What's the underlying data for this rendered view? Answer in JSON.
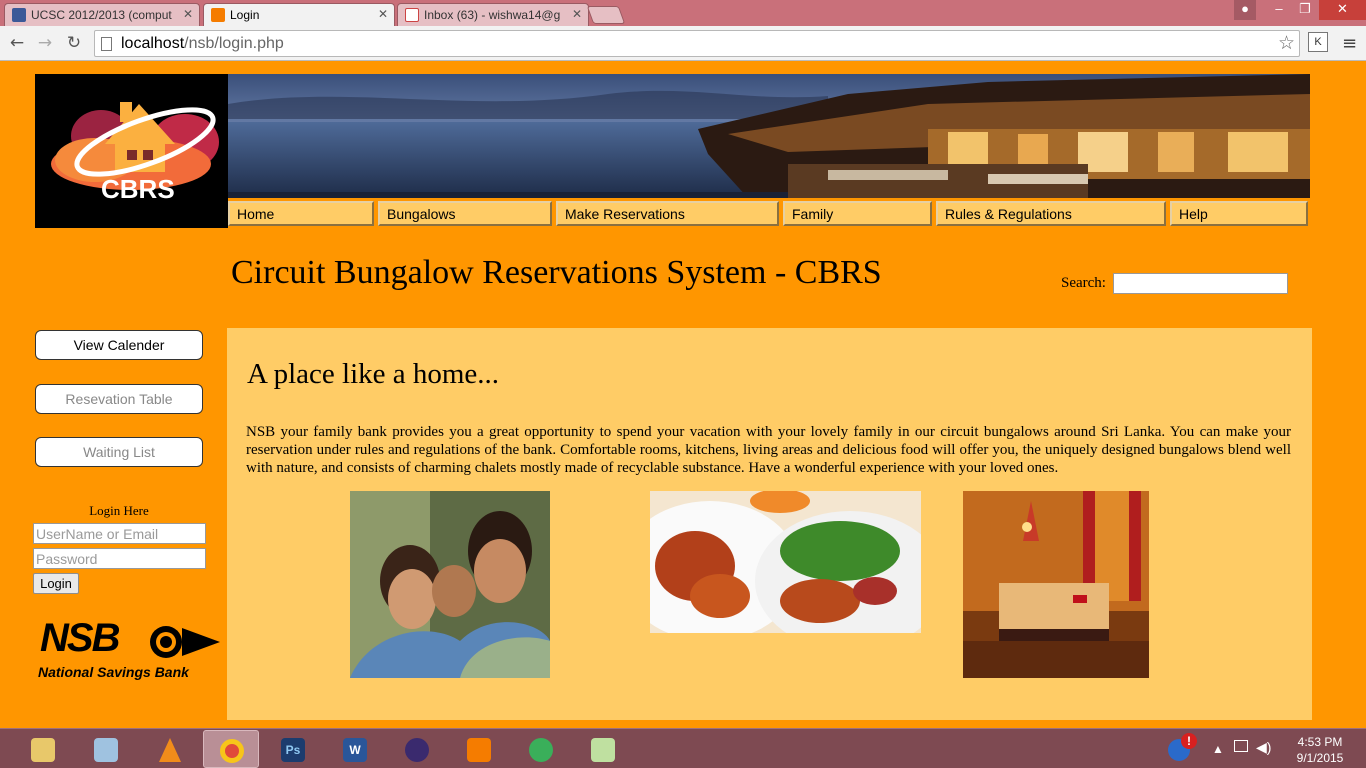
{
  "browser": {
    "tabs": [
      {
        "title": "UCSC 2012/2013 (comput",
        "active": false,
        "favicon": "facebook-icon"
      },
      {
        "title": "Login",
        "active": true,
        "favicon": "xampp-icon"
      },
      {
        "title": "Inbox (63) - wishwa14@g",
        "active": false,
        "favicon": "gmail-icon"
      }
    ],
    "url_host": "localhost",
    "url_path": "/nsb/login.php"
  },
  "site": {
    "logo_text": "CBRS",
    "title": "Circuit Bungalow Reservations System - CBRS",
    "search_label": "Search:"
  },
  "menu": [
    {
      "label": "Home"
    },
    {
      "label": "Bungalows"
    },
    {
      "label": "Make Reservations"
    },
    {
      "label": "Family"
    },
    {
      "label": "Rules & Regulations"
    },
    {
      "label": "Help"
    }
  ],
  "sidebar": {
    "view_calendar": "View Calender",
    "reservation_table": "Resevation Table",
    "waiting_list": "Waiting List"
  },
  "login": {
    "title": "Login Here",
    "username_placeholder": "UserName or Email",
    "password_placeholder": "Password",
    "button": "Login"
  },
  "nsb": {
    "logo_text": "NSB",
    "name": "National Savings Bank"
  },
  "content": {
    "heading": "A place like a home...",
    "intro": "NSB your family bank provides you a great opportunity to spend your vacation with your lovely family in our circuit bungalows around Sri Lanka. You can make your reservation under rules and regulations of the bank. Comfortable rooms, kitchens, living areas and delicious food will offer you, the uniquely designed bungalows blend well with nature, and consists of charming chalets mostly made of recyclable substance. Have a wonderful experience with your loved ones."
  },
  "taskbar": {
    "apps": [
      "file-explorer-icon",
      "notepad-icon",
      "vlc-icon",
      "chrome-icon",
      "photoshop-icon",
      "word-icon",
      "eclipse-icon",
      "xampp-icon",
      "monitor-icon",
      "notepadpp-icon"
    ],
    "photoshop_label": "Ps",
    "word_label": "W",
    "time": "4:53 PM",
    "date": "9/1/2015"
  }
}
